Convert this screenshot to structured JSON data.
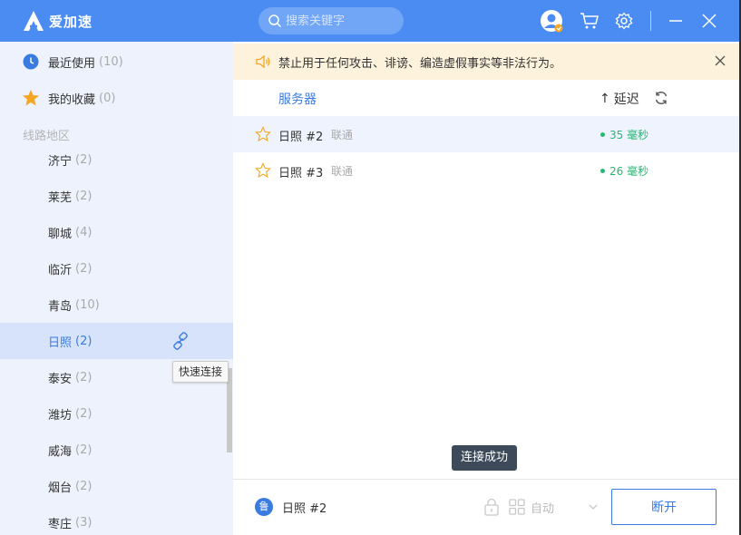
{
  "app": {
    "name": "爱加速",
    "logo_letter": "A"
  },
  "search": {
    "placeholder": "搜索关键字"
  },
  "sidebar": {
    "recent": {
      "label": "最近使用",
      "count": "(10)"
    },
    "favorites": {
      "label": "我的收藏",
      "count": "(0)"
    },
    "section_label": "线路地区",
    "regions": [
      {
        "label": "济宁",
        "count": "(2)"
      },
      {
        "label": "莱芜",
        "count": "(2)"
      },
      {
        "label": "聊城",
        "count": "(4)"
      },
      {
        "label": "临沂",
        "count": "(2)"
      },
      {
        "label": "青岛",
        "count": "(10)"
      },
      {
        "label": "日照",
        "count": "(2)"
      },
      {
        "label": "泰安",
        "count": "(2)"
      },
      {
        "label": "潍坊",
        "count": "(2)"
      },
      {
        "label": "威海",
        "count": "(2)"
      },
      {
        "label": "烟台",
        "count": "(2)"
      },
      {
        "label": "枣庄",
        "count": "(3)"
      }
    ],
    "active_region_index": 5,
    "tooltip": "快速连接"
  },
  "notice": {
    "text": "禁止用于任何攻击、诽谤、编造虚假事实等非法行为。"
  },
  "list_header": {
    "server": "服务器",
    "latency": "延迟",
    "sort_arrow": "↑"
  },
  "servers": [
    {
      "name": "日照 #2",
      "isp": "联通",
      "latency": "35 毫秒"
    },
    {
      "name": "日照 #3",
      "isp": "联通",
      "latency": "26 毫秒"
    }
  ],
  "toast": "连接成功",
  "bottom": {
    "region_badge": "鲁",
    "current_server": "日照 #2",
    "mode": "自动",
    "disconnect": "断开"
  },
  "colors": {
    "brand": "#4a8cf2",
    "accent": "#3a7be0",
    "latency_good": "#2bb673",
    "notice_bg": "#fdf3dd"
  }
}
